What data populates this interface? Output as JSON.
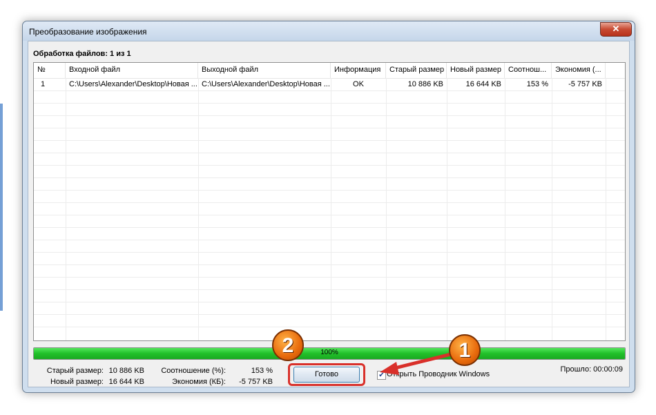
{
  "window": {
    "title": "Преобразование изображения",
    "close_label": "✕"
  },
  "status_line": "Обработка файлов: 1 из 1",
  "table": {
    "columns": [
      "№",
      "Входной файл",
      "Выходной файл",
      "Информация",
      "Старый размер",
      "Новый размер",
      "Соотнош...",
      "Экономия (..."
    ],
    "rows": [
      [
        "1",
        "C:\\Users\\Alexander\\Desktop\\Новая ...",
        "C:\\Users\\Alexander\\Desktop\\Новая ...",
        "OK",
        "10 886 KB",
        "16 644 KB",
        "153 %",
        "-5 757 KB"
      ]
    ]
  },
  "progress": {
    "value": 1.0,
    "label": "100%",
    "color": "#21c02a"
  },
  "stats": {
    "old_size_label": "Старый размер:",
    "old_size_value": "10 886 KB",
    "new_size_label": "Новый размер:",
    "new_size_value": "16 644 KB",
    "ratio_label": "Соотношение (%):",
    "ratio_value": "153 %",
    "savings_label": "Экономия (КБ):",
    "savings_value": "-5 757 KB"
  },
  "done_button_label": "Готово",
  "open_explorer": {
    "checked": true,
    "label": "Открыть Проводник Windows"
  },
  "elapsed": "Прошло: 00:00:09",
  "annotations": {
    "badge_1": "1",
    "badge_2": "2",
    "highlight_color": "#d9302a"
  }
}
